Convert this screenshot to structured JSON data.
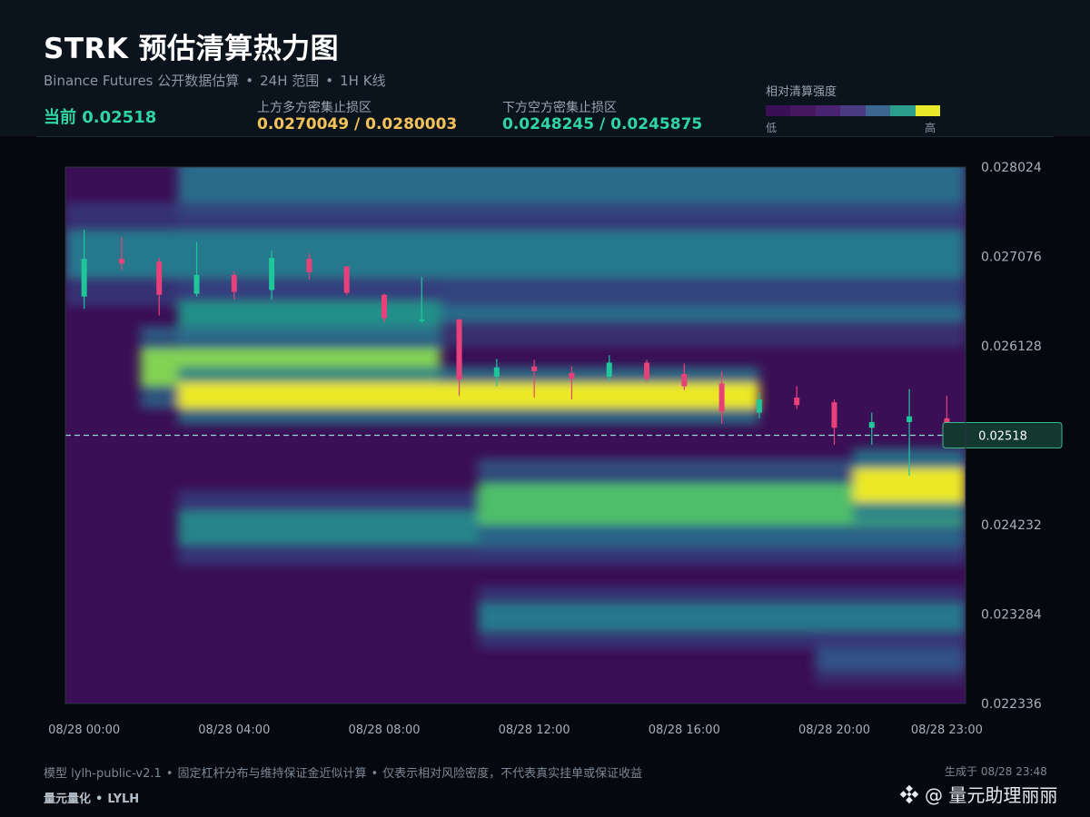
{
  "header": {
    "title": "STRK 预估清算热力图",
    "subtitle_source": "Binance Futures 公开数据估算",
    "subtitle_range": "24H 范围",
    "subtitle_interval": "1H K线",
    "separator": "•",
    "current_label": "当前 0.02518",
    "upper_zone_label": "上方多方密集止损区",
    "upper_zone_value": "0.0270049 / 0.0280003",
    "lower_zone_label": "下方空方密集止损区",
    "lower_zone_value": "0.0248245 / 0.0245875"
  },
  "legend": {
    "title": "相对清算强度",
    "low": "低",
    "high": "高",
    "colors": [
      "#3b0f55",
      "#44175f",
      "#4a2370",
      "#4a3a82",
      "#3a6690",
      "#2a9d8c",
      "#e8e928"
    ]
  },
  "colors": {
    "background": "#05080e",
    "header_background": "#0b131c",
    "up_candle": "#1fc69a",
    "down_candle": "#e8417a",
    "current_line": "#8fd7d2",
    "upper_zone_text": "#f4c25a",
    "lower_zone_text": "#2fd6a3"
  },
  "chart_data": {
    "type": "heatmap",
    "ylim": [
      0.022336,
      0.028024
    ],
    "y_ticks": [
      "0.028024",
      "0.027076",
      "0.026128",
      "0.025180",
      "0.024232",
      "0.023284",
      "0.022336"
    ],
    "y_tick_labels_shown": [
      "0.028024",
      "0.027076",
      "0.026128",
      "0.024232",
      "0.023284",
      "0.022336"
    ],
    "x_tick_labels": [
      "08/28 00:00",
      "08/28 04:00",
      "08/28 08:00",
      "08/28 12:00",
      "08/28 16:00",
      "08/28 20:00",
      "08/28 23:00"
    ],
    "x_tick_hours": [
      0,
      4,
      8,
      12,
      16,
      20,
      23
    ],
    "current_price": 0.02518,
    "current_price_label": "0.02518",
    "candles": [
      {
        "t": 0,
        "o": 0.02665,
        "h": 0.02736,
        "l": 0.02652,
        "c": 0.02705
      },
      {
        "t": 1,
        "o": 0.02705,
        "h": 0.02728,
        "l": 0.02693,
        "c": 0.027
      },
      {
        "t": 2,
        "o": 0.02702,
        "h": 0.02706,
        "l": 0.02645,
        "c": 0.02667
      },
      {
        "t": 3,
        "o": 0.02668,
        "h": 0.02723,
        "l": 0.02665,
        "c": 0.02688
      },
      {
        "t": 4,
        "o": 0.02688,
        "h": 0.02692,
        "l": 0.02662,
        "c": 0.0267
      },
      {
        "t": 5,
        "o": 0.02672,
        "h": 0.02714,
        "l": 0.02662,
        "c": 0.02706
      },
      {
        "t": 6,
        "o": 0.02705,
        "h": 0.02711,
        "l": 0.02683,
        "c": 0.02691
      },
      {
        "t": 7,
        "o": 0.02697,
        "h": 0.02697,
        "l": 0.02667,
        "c": 0.02669
      },
      {
        "t": 8,
        "o": 0.02667,
        "h": 0.02668,
        "l": 0.02638,
        "c": 0.02642
      },
      {
        "t": 9,
        "o": 0.02641,
        "h": 0.02686,
        "l": 0.02637,
        "c": 0.02641
      },
      {
        "t": 10,
        "o": 0.02641,
        "h": 0.02641,
        "l": 0.0256,
        "c": 0.02577
      },
      {
        "t": 11,
        "o": 0.0258,
        "h": 0.02599,
        "l": 0.0257,
        "c": 0.0259
      },
      {
        "t": 12,
        "o": 0.02591,
        "h": 0.02598,
        "l": 0.02558,
        "c": 0.02586
      },
      {
        "t": 13,
        "o": 0.02584,
        "h": 0.02591,
        "l": 0.02556,
        "c": 0.02578
      },
      {
        "t": 14,
        "o": 0.0258,
        "h": 0.02603,
        "l": 0.02575,
        "c": 0.02595
      },
      {
        "t": 15,
        "o": 0.02595,
        "h": 0.02598,
        "l": 0.02575,
        "c": 0.02578
      },
      {
        "t": 16,
        "o": 0.02583,
        "h": 0.02594,
        "l": 0.02566,
        "c": 0.0257
      },
      {
        "t": 17,
        "o": 0.02573,
        "h": 0.02586,
        "l": 0.0253,
        "c": 0.02543
      },
      {
        "t": 18,
        "o": 0.02542,
        "h": 0.02563,
        "l": 0.02536,
        "c": 0.02556
      },
      {
        "t": 19,
        "o": 0.02558,
        "h": 0.0257,
        "l": 0.02546,
        "c": 0.0255
      },
      {
        "t": 20,
        "o": 0.02553,
        "h": 0.02556,
        "l": 0.02508,
        "c": 0.02526
      },
      {
        "t": 21,
        "o": 0.02526,
        "h": 0.02542,
        "l": 0.02508,
        "c": 0.02532
      },
      {
        "t": 22,
        "o": 0.02532,
        "h": 0.02567,
        "l": 0.02475,
        "c": 0.02538
      },
      {
        "t": 23,
        "o": 0.02536,
        "h": 0.0256,
        "l": 0.0251,
        "c": 0.02518
      }
    ],
    "heat_bands": [
      {
        "y": 0.0256,
        "t0": 3,
        "t1": 18.5,
        "intensity": 1.0,
        "width": 0.00014
      },
      {
        "y": 0.0259,
        "t0": 2,
        "t1": 10,
        "intensity": 0.85,
        "width": 0.0002
      },
      {
        "y": 0.0264,
        "t0": 3,
        "t1": 10,
        "intensity": 0.55,
        "width": 0.0002
      },
      {
        "y": 0.02445,
        "t0": 11,
        "t1": 24,
        "intensity": 0.75,
        "width": 0.00022
      },
      {
        "y": 0.02465,
        "t0": 21,
        "t1": 24,
        "intensity": 1.0,
        "width": 0.00018
      },
      {
        "y": 0.0242,
        "t0": 3,
        "t1": 24,
        "intensity": 0.5,
        "width": 0.00018
      },
      {
        "y": 0.0271,
        "t0": 0,
        "t1": 24,
        "intensity": 0.45,
        "width": 0.00025
      },
      {
        "y": 0.0278,
        "t0": 3,
        "t1": 24,
        "intensity": 0.4,
        "width": 0.0003
      },
      {
        "y": 0.0266,
        "t0": 10,
        "t1": 24,
        "intensity": 0.4,
        "width": 0.00022
      },
      {
        "y": 0.02325,
        "t0": 11,
        "t1": 24,
        "intensity": 0.45,
        "width": 0.00015
      },
      {
        "y": 0.0228,
        "t0": 20,
        "t1": 24,
        "intensity": 0.3,
        "width": 0.00012
      }
    ]
  },
  "footer": {
    "model": "模型 lylh-public-v2.1",
    "method": "固定杠杆分布与维持保证金近似计算",
    "disclaimer": "仅表示相对风险密度，不代表真实挂单或保证收益",
    "separator": "•",
    "brand_name": "量元量化",
    "brand_code": "LYLH",
    "generated": "生成于 08/28 23:48",
    "watermark": "@ 量元助理丽丽"
  }
}
